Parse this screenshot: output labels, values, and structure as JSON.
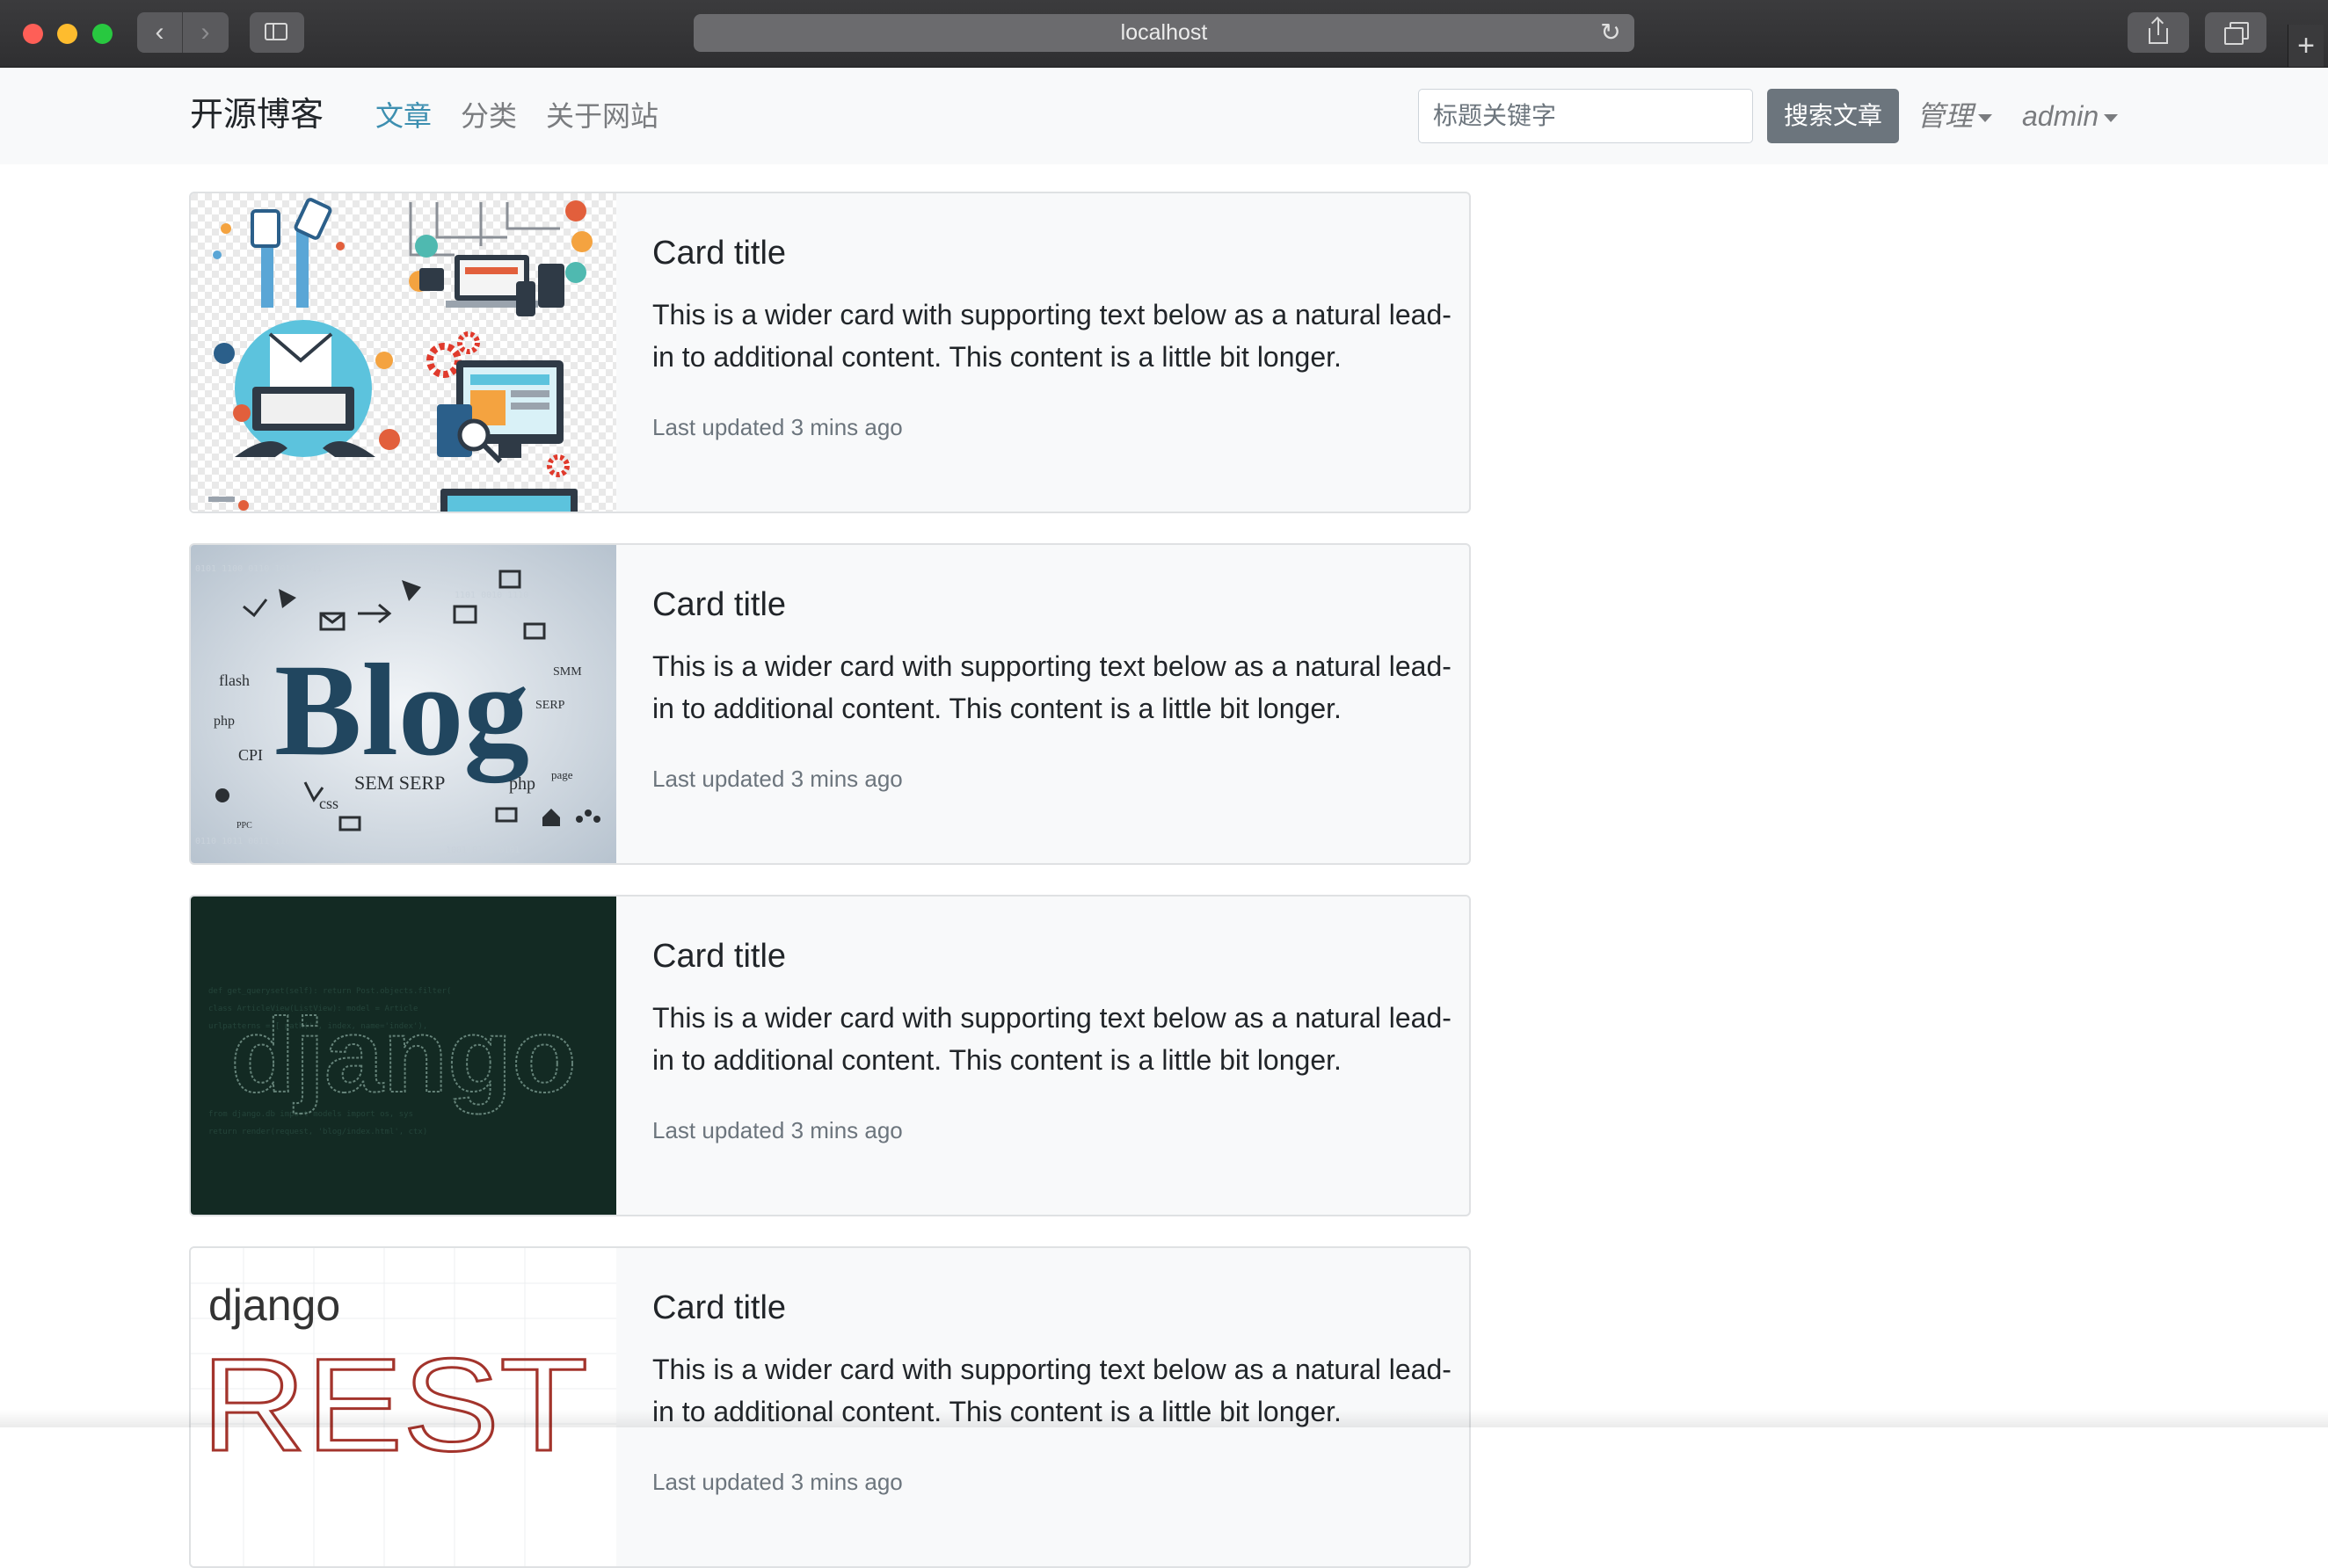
{
  "browser": {
    "url": "localhost"
  },
  "navbar": {
    "brand": "开源博客",
    "links": [
      {
        "label": "文章",
        "active": true
      },
      {
        "label": "分类",
        "active": false
      },
      {
        "label": "关于网站",
        "active": false
      }
    ],
    "search": {
      "placeholder": "标题关键字",
      "button_label": "搜索文章"
    },
    "dropdowns": [
      {
        "label": "管理"
      },
      {
        "label": "admin"
      }
    ]
  },
  "cards": [
    {
      "title": "Card title",
      "text": "This is a wider card with supporting text below as a natural lead-in to additional content. This content is a little bit longer.",
      "meta": "Last updated 3 mins ago",
      "image": "tech-devices-illustration"
    },
    {
      "title": "Card title",
      "text": "This is a wider card with supporting text below as a natural lead-in to additional content. This content is a little bit longer.",
      "meta": "Last updated 3 mins ago",
      "image": "blog-word-cloud",
      "image_text": [
        "Blog",
        "flash",
        "php",
        "CPI",
        "SEM SERP",
        "css",
        "SMM",
        "SERP",
        "PPC",
        "page"
      ]
    },
    {
      "title": "Card title",
      "text": "This is a wider card with supporting text below as a natural lead-in to additional content. This content is a little bit longer.",
      "meta": "Last updated 3 mins ago",
      "image": "django-code-art",
      "image_text": [
        "django"
      ]
    },
    {
      "title": "Card title",
      "text": "This is a wider card with supporting text below as a natural lead-in to additional content. This content is a little bit longer.",
      "meta": "Last updated 3 mins ago",
      "image": "django-rest-logo",
      "image_text": [
        "django",
        "REST"
      ]
    }
  ],
  "colors": {
    "navbar_bg": "#f8f9fa",
    "active_link": "#3d8fb0",
    "button_bg": "#6c757d",
    "chrome_bg": "#2f2f31"
  }
}
